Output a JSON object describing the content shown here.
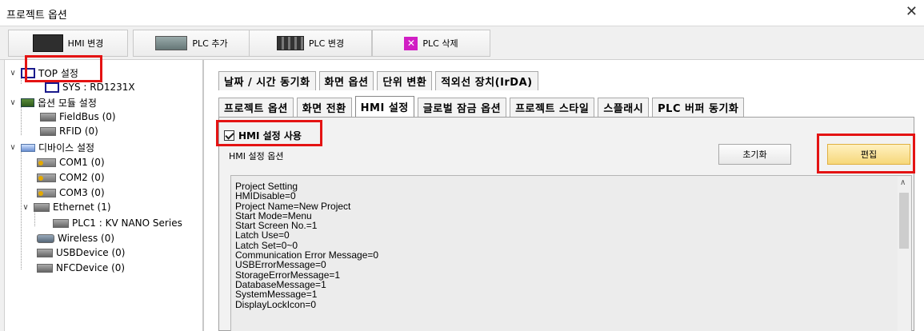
{
  "window": {
    "title": "프로젝트 옵션",
    "close_glyph": "✕"
  },
  "toolbar": {
    "buttons": [
      {
        "label": "HMI 변경",
        "icon": "hmi-monitor-icon"
      },
      {
        "label": "PLC 추가",
        "icon": "plc-icon"
      },
      {
        "label": "PLC 변경",
        "icon": "plc-change-icon"
      },
      {
        "label": "PLC 삭제",
        "icon": "delete-icon"
      }
    ]
  },
  "tree": {
    "top": "TOP 설정",
    "sys": "SYS : RD1231X",
    "option_modules": "옵션 모듈 설정",
    "fieldbus": "FieldBus (0)",
    "rfid": "RFID (0)",
    "devices": "디바이스 설정",
    "com1": "COM1 (0)",
    "com2": "COM2 (0)",
    "com3": "COM3 (0)",
    "ethernet": "Ethernet (1)",
    "plc1": "PLC1 : KV NANO Series",
    "wireless": "Wireless (0)",
    "usbdevice": "USBDevice (0)",
    "nfcdevice": "NFCDevice (0)"
  },
  "tabs_row1": [
    "날짜 / 시간 동기화",
    "화면 옵션",
    "단위 변환",
    "적외선 장치(IrDA)"
  ],
  "tabs_row2": [
    "프로젝트 옵션",
    "화면 전환",
    "HMI 설정",
    "글로벌 잠금 옵션",
    "프로젝트 스타일",
    "스플래시",
    "PLC 버퍼 동기화"
  ],
  "active_tab": "HMI 설정",
  "hmi": {
    "enable_label": "HMI 설정 사용",
    "enable_checked": true,
    "options_label": "HMI 설정 옵션",
    "reset_button": "초기화",
    "edit_button": "편집",
    "settings_lines": [
      "Project Setting",
      "HMIDisable=0",
      "Project Name=New Project",
      "Start Mode=Menu",
      "Start Screen No.=1",
      "Latch Use=0",
      "Latch Set=0~0",
      "Communication Error Message=0",
      "USBErrorMessage=0",
      "StorageErrorMessage=1",
      "DatabaseMessage=1",
      "SystemMessage=1",
      "DisplayLockIcon=0"
    ]
  },
  "highlight_color": "#e41313"
}
